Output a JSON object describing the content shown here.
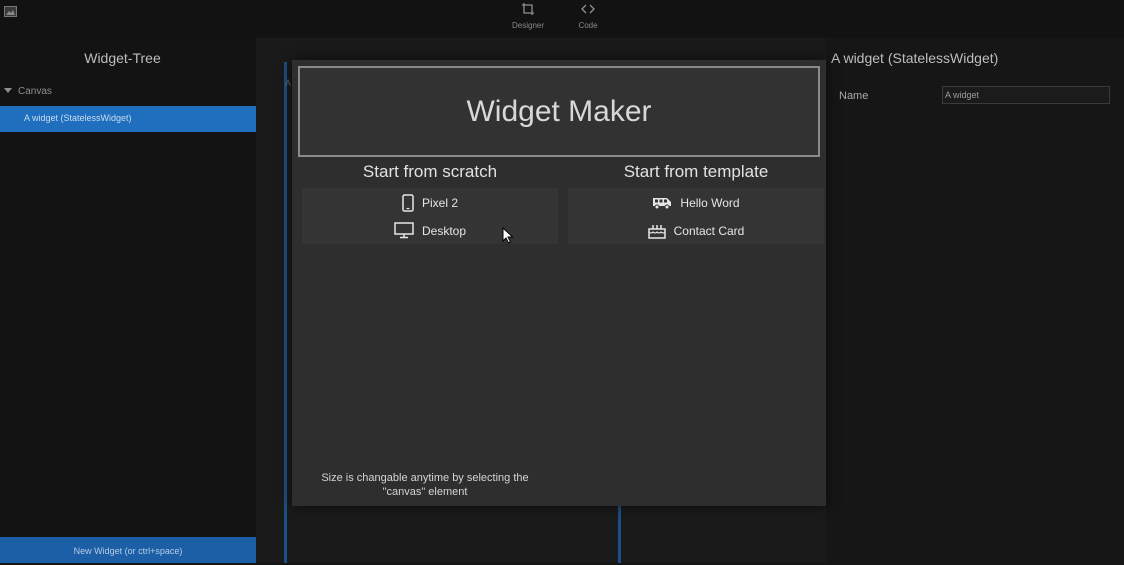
{
  "toolbar": {
    "designer_label": "Designer",
    "code_label": "Code"
  },
  "left_panel": {
    "title": "Widget-Tree",
    "tree": {
      "root_label": "Canvas",
      "selected_label": "A widget (StatelessWidget)"
    },
    "new_widget_label": "New Widget (or ctrl+space)"
  },
  "center": {
    "marker": "A"
  },
  "right_panel": {
    "title": "A widget (StatelessWidget)",
    "name_label": "Name",
    "name_value": "A widget"
  },
  "modal": {
    "title": "Widget Maker",
    "scratch": {
      "heading": "Start from scratch",
      "options": [
        {
          "label": "Pixel 2",
          "icon": "phone-icon"
        },
        {
          "label": "Desktop",
          "icon": "monitor-icon"
        }
      ]
    },
    "template": {
      "heading": "Start from template",
      "options": [
        {
          "label": "Hello Word",
          "icon": "bus-icon"
        },
        {
          "label": "Contact Card",
          "icon": "cake-icon"
        }
      ]
    },
    "footnote_line1": "Size is changable anytime by selecting the",
    "footnote_line2": "\"canvas\" element"
  },
  "colors": {
    "accent": "#1f6fbe",
    "modal_bg": "#2e2e2f",
    "page_bg": "#151516"
  }
}
